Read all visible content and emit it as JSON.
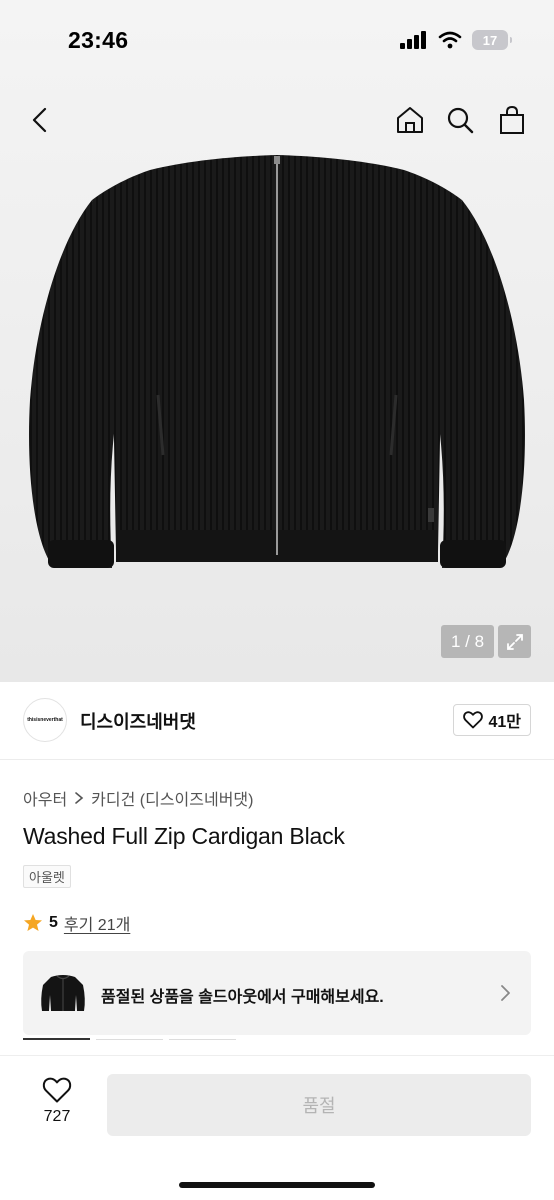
{
  "status_bar": {
    "time": "23:46",
    "battery": "17"
  },
  "gallery": {
    "counter": "1 / 8"
  },
  "brand": {
    "logo_text": "thisisneverthat",
    "name": "디스이즈네버댓",
    "likes": "41만"
  },
  "breadcrumb": {
    "category": "아우터",
    "subcategory": "카디건 (디스이즈네버댓)"
  },
  "product": {
    "title": "Washed Full Zip Cardigan Black",
    "tag": "아울렛"
  },
  "rating": {
    "score": "5",
    "reviews": "후기 21개",
    "star_color": "#f5a623"
  },
  "soldout_banner": {
    "text": "품절된 상품을 솔드아웃에서 구매해보세요."
  },
  "bottom_bar": {
    "wish_count": "727",
    "buy_label": "품절"
  }
}
